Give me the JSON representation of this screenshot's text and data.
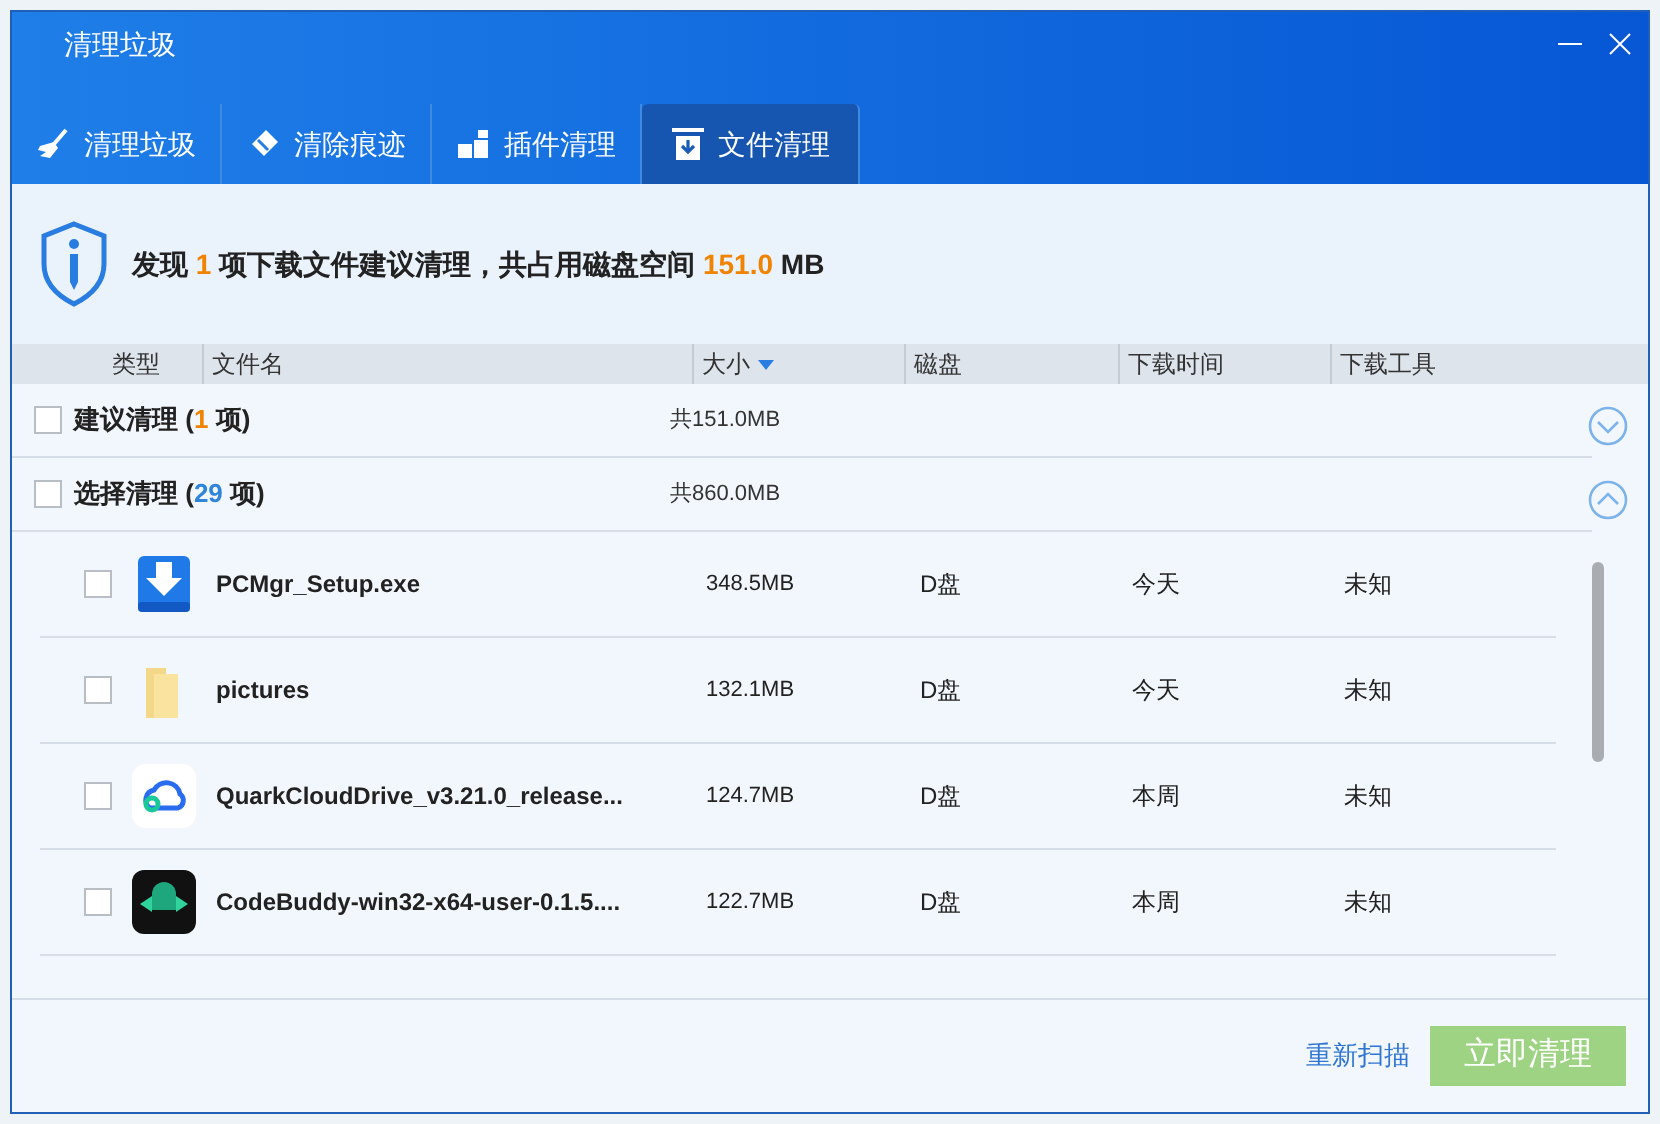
{
  "window": {
    "title": "清理垃圾"
  },
  "tabs": [
    {
      "label": "清理垃圾",
      "kind": "broom",
      "selected": false
    },
    {
      "label": "清除痕迹",
      "kind": "eraser",
      "selected": false
    },
    {
      "label": "插件清理",
      "kind": "puzzle",
      "selected": false
    },
    {
      "label": "文件清理",
      "kind": "download-box",
      "selected": true
    }
  ],
  "summary": {
    "before": "发现",
    "count": "1",
    "middle": "项下载文件建议清理，共占用磁盘空间",
    "size": "151.0",
    "unit": "MB"
  },
  "columns": [
    {
      "label": "类型",
      "sorted": false
    },
    {
      "label": "文件名",
      "sorted": false
    },
    {
      "label": "大小",
      "sorted": true
    },
    {
      "label": "磁盘",
      "sorted": false
    },
    {
      "label": "下载时间",
      "sorted": false
    },
    {
      "label": "下载工具",
      "sorted": false
    }
  ],
  "groups": [
    {
      "prefix": "建议清理 (",
      "count": "1",
      "suffix": "项)",
      "color": "#f08300",
      "total": "共151.0MB",
      "checked": false,
      "expanded": false
    },
    {
      "prefix": "选择清理 (",
      "count": "29",
      "suffix": "项)",
      "color": "#2f86d8",
      "total": "共860.0MB",
      "checked": false,
      "expanded": true
    }
  ],
  "files": [
    {
      "kind": "download",
      "name": "PCMgr_Setup.exe",
      "size": "348.5MB",
      "disk": "D盘",
      "time": "今天",
      "tool": "未知",
      "checked": false
    },
    {
      "kind": "folder",
      "name": "pictures",
      "size": "132.1MB",
      "disk": "D盘",
      "time": "今天",
      "tool": "未知",
      "checked": false
    },
    {
      "kind": "cloud",
      "name": "QuarkCloudDrive_v3.21.0_release...",
      "size": "124.7MB",
      "disk": "D盘",
      "time": "本周",
      "tool": "未知",
      "checked": false
    },
    {
      "kind": "app",
      "name": "CodeBuddy-win32-x64-user-0.1.5....",
      "size": "122.7MB",
      "disk": "D盘",
      "time": "本周",
      "tool": "未知",
      "checked": false
    }
  ],
  "footer": {
    "rescan": "重新扫描",
    "clean": {
      "label": "立即清理",
      "disabled": true
    }
  }
}
